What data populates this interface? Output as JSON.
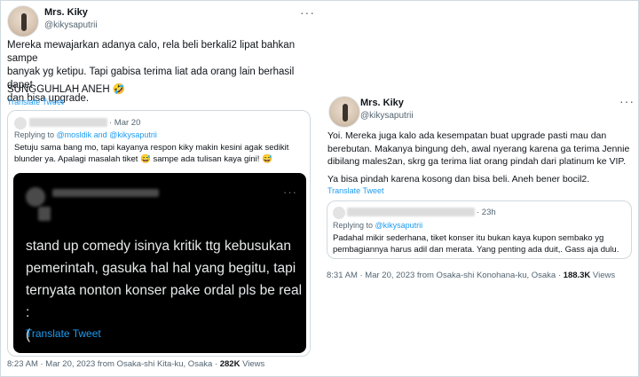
{
  "left_tweet": {
    "display_name": "Mrs. Kiky",
    "handle": "@kikysaputrii",
    "more_icon": "more-horizontal-icon",
    "text_lines": [
      "Mereka mewajarkan adanya calo, rela beli berkali2 lipat bahkan sampe",
      "banyak yg ketipu. Tapi gabisa terima liat ada orang lain berhasil dapet",
      "dan bisa upgrade."
    ],
    "text_2": "SUNGGUHLAH ANEH 🤣",
    "translate_label": "Translate Tweet",
    "quote": {
      "date": "· Mar 20",
      "replying_prefix": "Replying to ",
      "replying_mentions": "@mosldik and @kikysaputrii",
      "text_lines": [
        "Setuju sama bang mo, tapi kayanya respon kiky makin kesini agak sedikit",
        "blunder ya. Apalagi masalah tiket 😅 sampe ada tulisan kaya gini! 😅"
      ],
      "embedded": {
        "text_lines": [
          "stand up comedy isinya kritik ttg kebusukan",
          "pemerintah, gasuka hal hal yang begitu, tapi",
          "ternyata nonton konser pake ordal pls be real :",
          "("
        ],
        "translate_label": "Translate Tweet",
        "more_icon": "more-horizontal-icon"
      }
    },
    "footer_prefix": "8:23 AM · Mar 20, 2023 from Osaka-shi Kita-ku, Osaka · ",
    "views_count": "282K",
    "views_label": " Views"
  },
  "right_tweet": {
    "display_name": "Mrs. Kiky",
    "handle": "@kikysaputrii",
    "more_icon": "more-horizontal-icon",
    "text_lines": [
      "Yoi. Mereka juga kalo ada kesempatan buat upgrade pasti mau dan",
      "berebutan. Makanya bingung deh, awal nyerang karena ga terima Jennie",
      "dibilang males2an, skrg ga terima liat orang pindah dari platinum ke VIP."
    ],
    "text_2": "Ya bisa pindah karena kosong dan bisa beli. Aneh bener bocil2.",
    "translate_label": "Translate Tweet",
    "quote": {
      "date": "· 23h",
      "replying_prefix": "Replying to ",
      "replying_mentions": "@kikysaputrii",
      "text_lines": [
        "Padahal mikir sederhana, tiket konser itu bukan kaya kupon sembako yg",
        "pembagiannya harus adil dan merata. Yang penting ada duit,. Gass aja dulu."
      ]
    },
    "footer_prefix": "8:31 AM · Mar 20, 2023 from Osaka-shi Konohana-ku, Osaka · ",
    "views_count": "188.3K",
    "views_label": " Views"
  },
  "colors": {
    "link": "#1d9bf0",
    "text": "#0f1419",
    "muted": "#536471",
    "border": "#cfd9de",
    "dark_card": "#000000"
  }
}
